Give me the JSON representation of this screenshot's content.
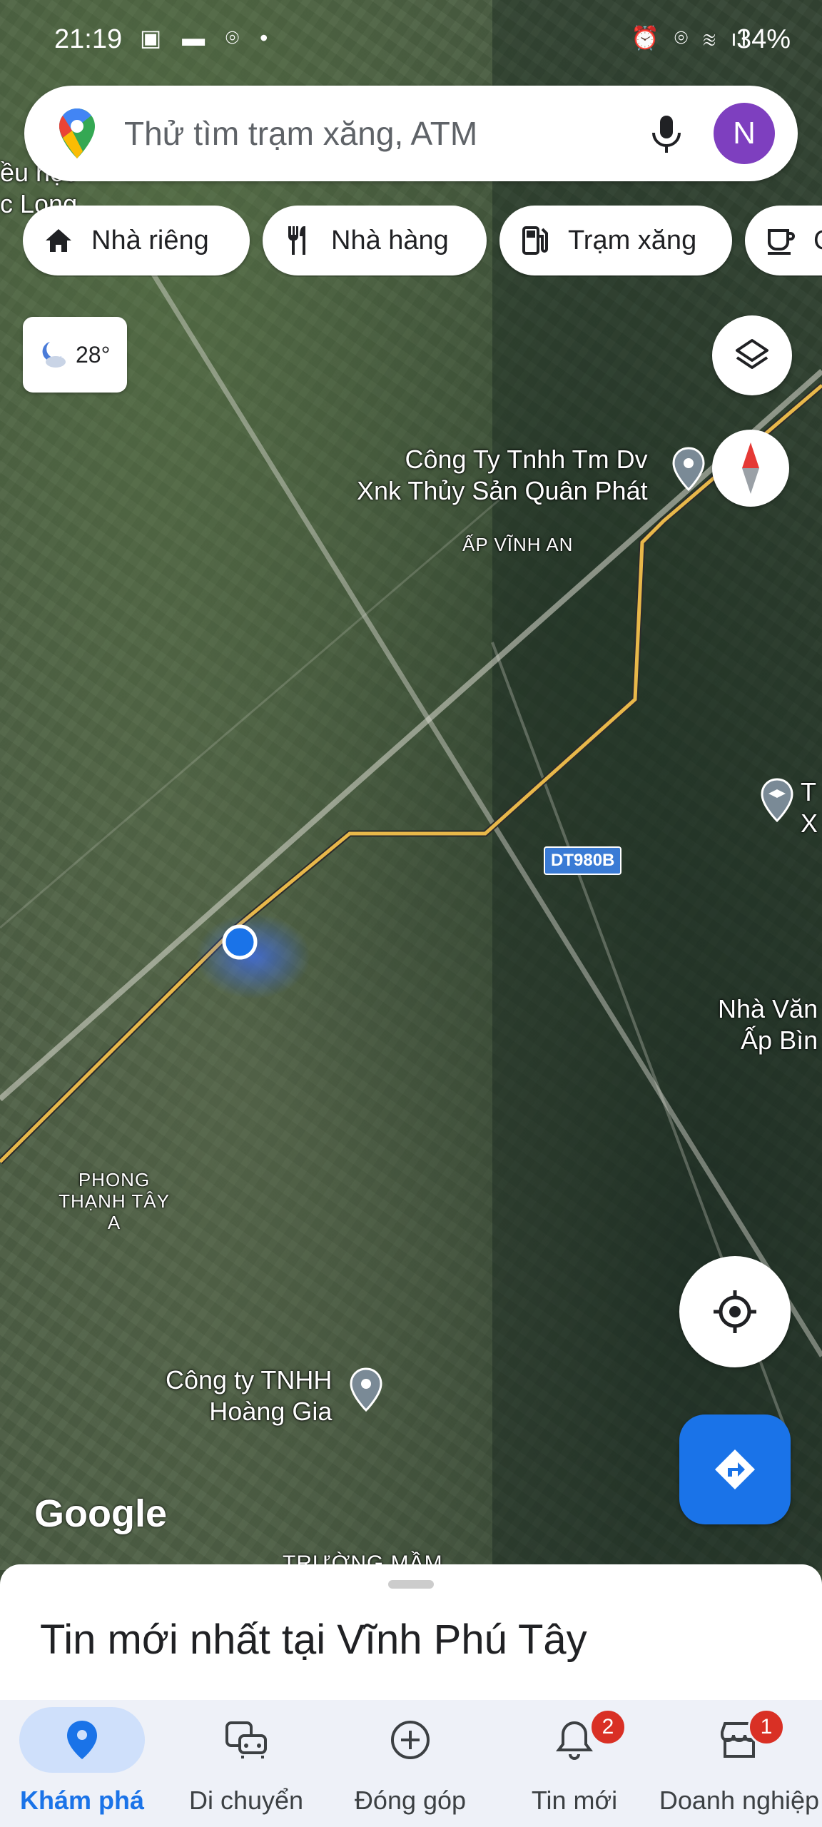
{
  "status_bar": {
    "time": "21:19",
    "battery": "34%"
  },
  "search": {
    "placeholder": "Thử tìm trạm xăng, ATM",
    "avatar_letter": "N"
  },
  "chips": [
    {
      "label": "Nhà riêng",
      "icon": "home-icon"
    },
    {
      "label": "Nhà hàng",
      "icon": "restaurant-icon"
    },
    {
      "label": "Trạm xăng",
      "icon": "gas-station-icon"
    },
    {
      "label": "C",
      "icon": "coffee-icon"
    }
  ],
  "weather": {
    "temp": "28°",
    "icon": "moon-cloud-icon"
  },
  "map": {
    "places": [
      {
        "line1": "Công Ty Tnhh Tm Dv",
        "line2": "Xnk Thủy Sản Quân Phát"
      },
      {
        "line1": "Công ty TNHH",
        "line2": "Hoàng Gia"
      },
      {
        "line1": "Nhà Văn",
        "line2": "Ấp Bìn"
      },
      {
        "line1": "T",
        "line2": "X"
      }
    ],
    "areas": [
      "ẤP VĨNH AN",
      "PHONG THẠNH TÂY A"
    ],
    "road_badge": "DT980B",
    "bottom_partial": "TRƯỜNG MẦM",
    "top_left_partial": [
      "ều học",
      "c Long"
    ],
    "attribution": "Google"
  },
  "sheet": {
    "title": "Tin mới nhất tại Vĩnh Phú Tây"
  },
  "nav": [
    {
      "label": "Khám phá",
      "icon": "explore-pin-icon",
      "active": true
    },
    {
      "label": "Di chuyển",
      "icon": "commute-icon"
    },
    {
      "label": "Đóng góp",
      "icon": "add-circle-icon"
    },
    {
      "label": "Tin mới",
      "icon": "bell-icon",
      "badge": "2"
    },
    {
      "label": "Doanh nghiệp",
      "icon": "store-icon",
      "badge": "1"
    }
  ],
  "colors": {
    "accent": "#1a73e8",
    "badge": "#d93025",
    "avatar": "#7e3fbf"
  }
}
